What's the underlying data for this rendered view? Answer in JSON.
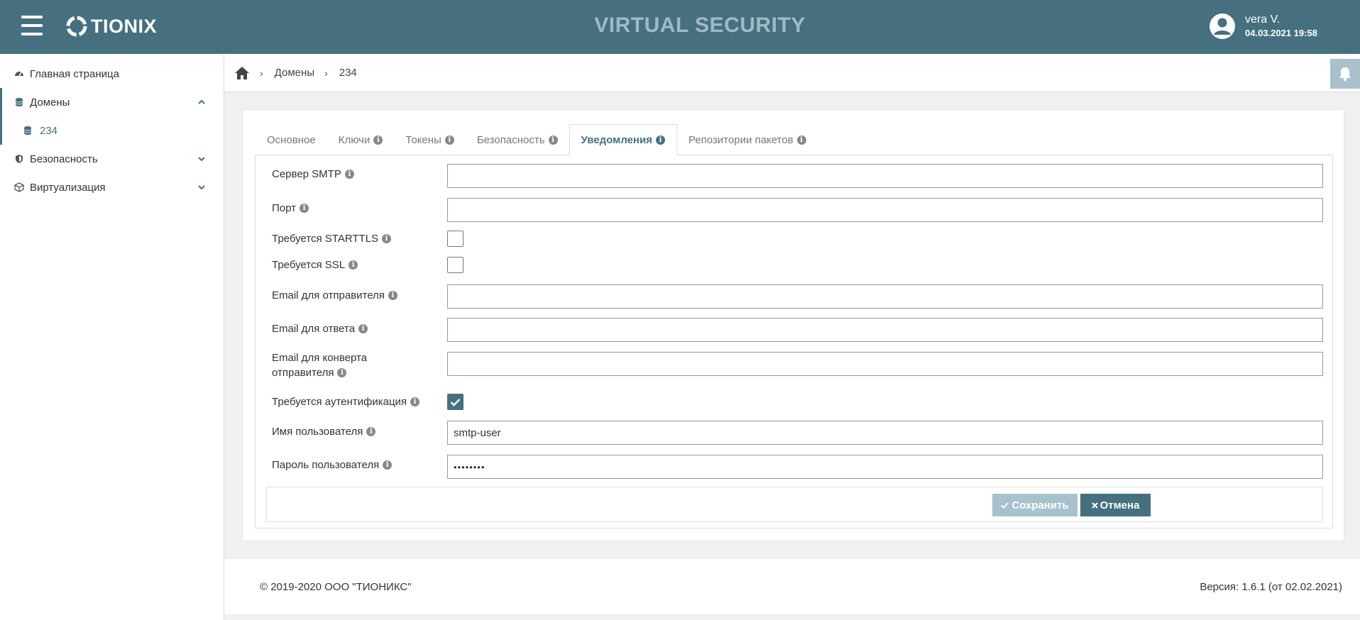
{
  "header": {
    "brand": "TIONIX",
    "app_title": "VIRTUAL SECURITY",
    "user_name": "vera V.",
    "user_datetime": "04.03.2021 19:58"
  },
  "sidebar": {
    "items": [
      {
        "label": "Главная страница",
        "icon": "dashboard-icon"
      },
      {
        "label": "Домены",
        "icon": "database-icon",
        "expanded": true
      },
      {
        "label": "234",
        "icon": "database-icon"
      },
      {
        "label": "Безопасность",
        "icon": "shield-icon",
        "expanded": false
      },
      {
        "label": "Виртуализация",
        "icon": "cube-icon",
        "expanded": false
      }
    ]
  },
  "breadcrumb": {
    "items": [
      "Домены",
      "234"
    ]
  },
  "tabs": [
    {
      "label": "Основное",
      "info": false
    },
    {
      "label": "Ключи",
      "info": true
    },
    {
      "label": "Токены",
      "info": true
    },
    {
      "label": "Безопасность",
      "info": true
    },
    {
      "label": "Уведомления",
      "info": true,
      "active": true
    },
    {
      "label": "Репозитории пакетов",
      "info": true
    }
  ],
  "form": {
    "smtp_server": {
      "label": "Сервер SMTP",
      "value": ""
    },
    "port": {
      "label": "Порт",
      "value": ""
    },
    "starttls": {
      "label": "Требуется STARTTLS",
      "checked": false
    },
    "ssl": {
      "label": "Требуется SSL",
      "checked": false
    },
    "sender_email": {
      "label": "Email для отправителя",
      "value": ""
    },
    "reply_email": {
      "label": "Email для ответа",
      "value": ""
    },
    "envelope_email": {
      "label_line1": "Email для конверта",
      "label_line2": "отправителя",
      "value": ""
    },
    "auth_required": {
      "label": "Требуется аутентификация",
      "checked": true
    },
    "username": {
      "label": "Имя пользователя",
      "value": "smtp-user"
    },
    "password": {
      "label": "Пароль пользователя",
      "value": "••••••••"
    }
  },
  "buttons": {
    "save": "Сохранить",
    "cancel": "Отмена"
  },
  "footer": {
    "copyright": "© 2019-2020 ООО \"ТИОНИКС\"",
    "version": "Версия: 1.6.1 (от 02.02.2021)"
  },
  "colors": {
    "header_bg": "#46707f",
    "accent": "#46707f",
    "save_disabled": "#a7c2cd"
  }
}
